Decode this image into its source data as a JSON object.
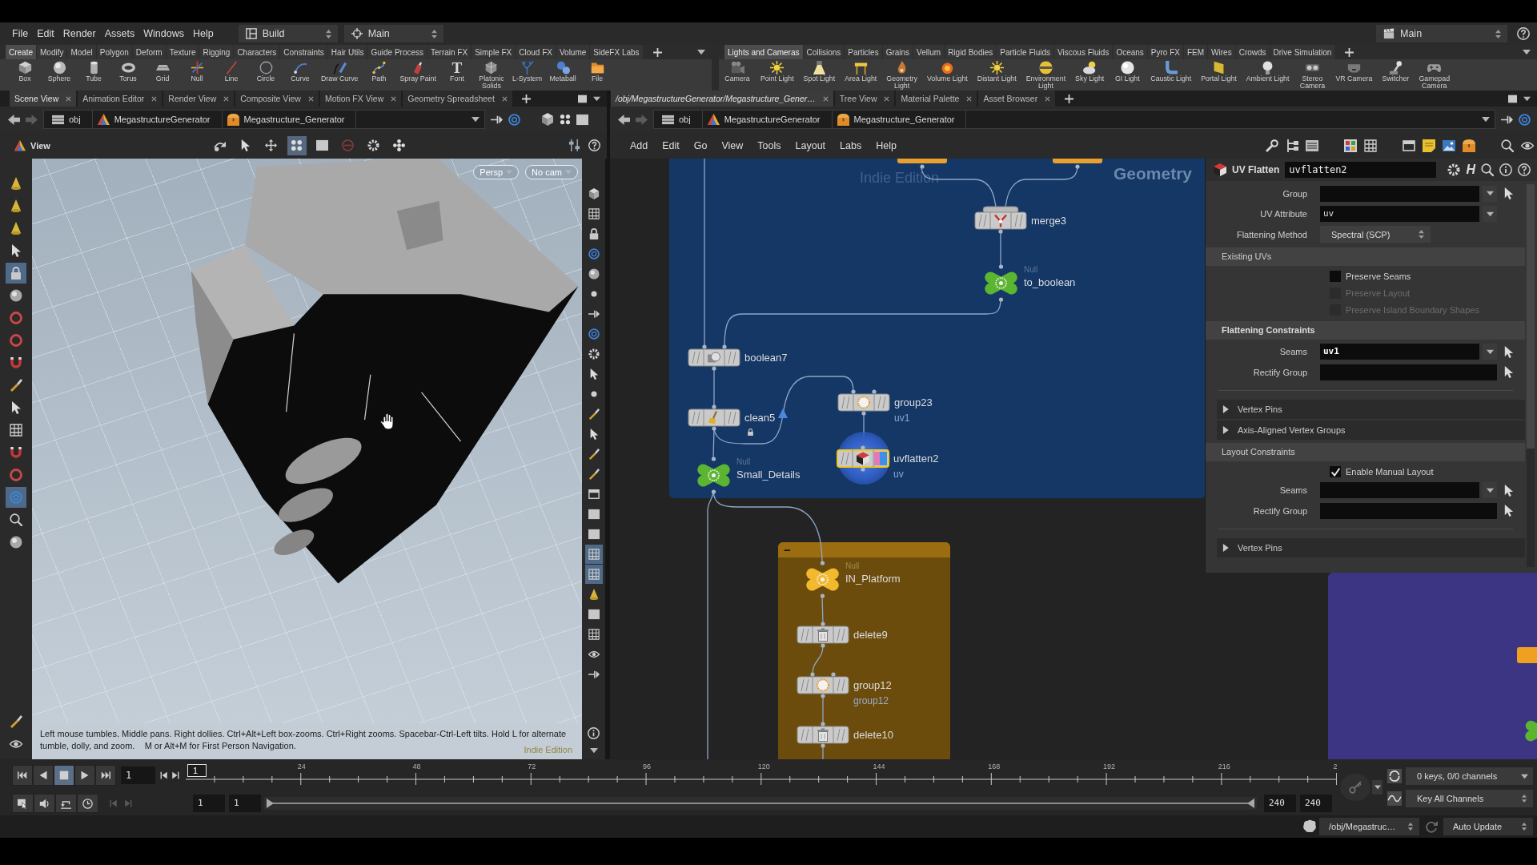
{
  "menu_bar": {
    "menus": [
      "File",
      "Edit",
      "Render",
      "Assets",
      "Windows",
      "Help"
    ],
    "desktop": "Build",
    "context": "Main",
    "right_desktop": "Main"
  },
  "shelf_left": {
    "tabs": [
      {
        "label": "Create",
        "selected": true
      },
      {
        "label": "Modify",
        "selected": false
      },
      {
        "label": "Model",
        "selected": false
      },
      {
        "label": "Polygon",
        "selected": false
      },
      {
        "label": "Deform",
        "selected": false
      },
      {
        "label": "Texture",
        "selected": false
      },
      {
        "label": "Rigging",
        "selected": false
      },
      {
        "label": "Characters",
        "selected": false
      },
      {
        "label": "Constraints",
        "selected": false
      },
      {
        "label": "Hair Utils",
        "selected": false
      },
      {
        "label": "Guide Process",
        "selected": false
      },
      {
        "label": "Terrain FX",
        "selected": false
      },
      {
        "label": "Simple FX",
        "selected": false
      },
      {
        "label": "Cloud FX",
        "selected": false
      },
      {
        "label": "Volume",
        "selected": false
      },
      {
        "label": "SideFX Labs",
        "selected": false
      }
    ],
    "tools": [
      {
        "label": "Box"
      },
      {
        "label": "Sphere"
      },
      {
        "label": "Tube"
      },
      {
        "label": "Torus"
      },
      {
        "label": "Grid"
      },
      {
        "label": "Null"
      },
      {
        "label": "Line"
      },
      {
        "label": "Circle"
      },
      {
        "label": "Curve"
      },
      {
        "label": "Draw Curve"
      },
      {
        "label": "Path"
      },
      {
        "label": "Spray Paint"
      },
      {
        "label": "Font",
        "glyph": "T"
      },
      {
        "label": "Platonic\nSolids"
      },
      {
        "label": "L-System"
      },
      {
        "label": "Metaball"
      },
      {
        "label": "File"
      }
    ]
  },
  "shelf_right": {
    "tabs": [
      {
        "label": "Lights and Cameras",
        "selected": true
      },
      {
        "label": "Collisions",
        "selected": false
      },
      {
        "label": "Particles",
        "selected": false
      },
      {
        "label": "Grains",
        "selected": false
      },
      {
        "label": "Vellum",
        "selected": false
      },
      {
        "label": "Rigid Bodies",
        "selected": false
      },
      {
        "label": "Particle Fluids",
        "selected": false
      },
      {
        "label": "Viscous Fluids",
        "selected": false
      },
      {
        "label": "Oceans",
        "selected": false
      },
      {
        "label": "Pyro FX",
        "selected": false
      },
      {
        "label": "FEM",
        "selected": false
      },
      {
        "label": "Wires",
        "selected": false
      },
      {
        "label": "Crowds",
        "selected": false
      },
      {
        "label": "Drive Simulation",
        "selected": false
      }
    ],
    "tools": [
      {
        "label": "Camera"
      },
      {
        "label": "Point Light"
      },
      {
        "label": "Spot Light"
      },
      {
        "label": "Area Light"
      },
      {
        "label": "Geometry\nLight"
      },
      {
        "label": "Volume Light"
      },
      {
        "label": "Distant Light"
      },
      {
        "label": "Environment\nLight"
      },
      {
        "label": "Sky Light"
      },
      {
        "label": "GI Light"
      },
      {
        "label": "Caustic Light"
      },
      {
        "label": "Portal Light"
      },
      {
        "label": "Ambient Light"
      },
      {
        "label": "Stereo\nCamera"
      },
      {
        "label": "VR Camera"
      },
      {
        "label": "Switcher"
      },
      {
        "label": "Gamepad\nCamera"
      }
    ]
  },
  "scene_pane": {
    "tabs": [
      {
        "label": "Scene View",
        "selected": true
      },
      {
        "label": "Animation Editor",
        "selected": false
      },
      {
        "label": "Render View",
        "selected": false
      },
      {
        "label": "Composite View",
        "selected": false
      },
      {
        "label": "Motion FX View",
        "selected": false
      },
      {
        "label": "Geometry Spreadsheet",
        "selected": false
      }
    ],
    "path": [
      "obj",
      "MegastructureGenerator",
      "Megastructure_Generator"
    ],
    "view_label": "View",
    "top_tools": [
      {
        "on": false
      },
      {
        "on": false
      },
      {
        "on": false
      },
      {
        "on": true
      },
      {
        "on": false
      },
      {
        "on": false
      },
      {
        "on": false
      },
      {
        "on": false
      }
    ],
    "left_tools": [
      {
        "on": false
      },
      {
        "on": false
      },
      {
        "on": false
      },
      {
        "on": false
      },
      {
        "on": true
      },
      {
        "on": false
      },
      {
        "on": false
      },
      {
        "on": false
      },
      {
        "on": false
      },
      {
        "on": false
      },
      {
        "on": false
      },
      {
        "on": false
      },
      {
        "on": false
      },
      {
        "on": false
      },
      {
        "on": true
      },
      {
        "on": false
      },
      {
        "on": false
      },
      {
        "on": false
      },
      {
        "on": false
      }
    ],
    "right_tools": [
      {
        "on": false
      },
      {
        "on": false
      },
      {
        "on": false
      },
      {
        "on": false
      },
      {
        "on": false
      },
      {
        "on": false
      },
      {
        "on": false
      },
      {
        "on": false
      },
      {
        "on": false
      },
      {
        "on": false
      },
      {
        "on": false
      },
      {
        "on": false
      },
      {
        "on": false
      },
      {
        "on": false
      },
      {
        "on": false
      },
      {
        "on": false
      },
      {
        "on": false
      },
      {
        "on": false
      },
      {
        "on": true
      },
      {
        "on": true
      },
      {
        "on": false
      },
      {
        "on": false
      },
      {
        "on": false
      },
      {
        "on": false
      },
      {
        "on": false
      }
    ],
    "camera_menus": [
      "Persp",
      "No cam"
    ],
    "help_text": "Left mouse tumbles. Middle pans. Right dollies. Ctrl+Alt+Left box-zooms. Ctrl+Right zooms. Spacebar-Ctrl-Left tilts. Hold L for alternate tumble, dolly, and zoom.    M or Alt+M for First Person Navigation.",
    "edition_label": "Indie Edition"
  },
  "network_pane": {
    "tabs": [
      {
        "label": "/obj/MegastructureGenerator/Megastructure_Gener…",
        "kind": "path",
        "selected": true
      },
      {
        "label": "Tree View",
        "kind": "pane",
        "selected": false
      },
      {
        "label": "Material Palette",
        "kind": "pane",
        "selected": false
      },
      {
        "label": "Asset Browser",
        "kind": "pane",
        "selected": false
      }
    ],
    "path": [
      "obj",
      "MegastructureGenerator",
      "Megastructure_Generator"
    ],
    "menus": [
      "Add",
      "Edit",
      "Go",
      "View",
      "Tools",
      "Layout",
      "Labs",
      "Help"
    ],
    "edition_label": "Indie Edition",
    "boxes": [
      {
        "label": "Geometry",
        "color": "#143766"
      },
      {
        "collapse_glyph": "−",
        "color": "#6b4c0c"
      },
      {
        "color": "#3b3583"
      }
    ],
    "nodes": [
      {
        "name": "merge3",
        "kind": "merge",
        "color": "#cacaca",
        "selected": false,
        "display_flag": false,
        "locked": false
      },
      {
        "name": "to_boolean",
        "kind": "null",
        "type_label": "Null",
        "color": "#5cb531",
        "selected": false,
        "display_flag": false,
        "locked": false
      },
      {
        "name": "boolean7",
        "kind": "sop",
        "color": "#cacaca",
        "selected": false,
        "display_flag": false,
        "locked": false
      },
      {
        "name": "clean5",
        "kind": "sop",
        "color": "#cacaca",
        "selected": false,
        "display_flag": false,
        "locked": true
      },
      {
        "name": "group23",
        "kind": "sop",
        "comment": "uv1",
        "color": "#cacaca",
        "selected": false,
        "display_flag": false,
        "locked": false
      },
      {
        "name": "Small_Details",
        "kind": "null",
        "type_label": "Null",
        "color": "#5cb531",
        "selected": false,
        "display_flag": false,
        "locked": false
      },
      {
        "name": "uvflatten2",
        "kind": "sop",
        "comment": "uv",
        "color": "#cacaca",
        "selected": true,
        "display_flag": true,
        "locked": false
      },
      {
        "name": "IN_Platform",
        "kind": "null",
        "type_label": "Null",
        "color": "#f2b82e",
        "selected": false,
        "display_flag": false,
        "locked": false
      },
      {
        "name": "delete9",
        "kind": "sop",
        "color": "#cacaca",
        "selected": false,
        "display_flag": false,
        "locked": false
      },
      {
        "name": "group12",
        "kind": "sop",
        "comment": "group12",
        "color": "#cacaca",
        "selected": false,
        "display_flag": false,
        "locked": false
      },
      {
        "name": "delete10",
        "kind": "sop",
        "color": "#cacaca",
        "selected": false,
        "display_flag": false,
        "locked": false
      }
    ],
    "partial_nodes": [
      {
        "kind": "sop",
        "color": "#e8a030"
      },
      {
        "kind": "sop",
        "color": "#e8a030"
      },
      {
        "kind": "sop",
        "color": "#f0a020"
      },
      {
        "kind": "null",
        "color": "#5cb531"
      }
    ]
  },
  "parameters": {
    "node_type": "UV Flatten",
    "node_name": "uvflatten2",
    "header_glyph": "H",
    "rows": [
      {
        "kind": "field",
        "label": "Group",
        "menu": true,
        "picker": true
      },
      {
        "kind": "field",
        "label": "UV Attribute",
        "value": "uv",
        "menu": true,
        "picker": false,
        "modified": false
      },
      {
        "kind": "menu",
        "label": "Flattening Method",
        "value": "Spectral (SCP)"
      },
      {
        "kind": "section",
        "label": "Existing UVs",
        "modified": false
      },
      {
        "kind": "checkbox",
        "label": "Preserve Seams",
        "checked": false,
        "disabled": false
      },
      {
        "kind": "checkbox",
        "label": "Preserve Layout",
        "checked": false,
        "disabled": true
      },
      {
        "kind": "checkbox",
        "label": "Preserve Island Boundary Shapes",
        "checked": false,
        "disabled": true
      },
      {
        "kind": "section",
        "label": "Flattening Constraints",
        "modified": true
      },
      {
        "kind": "field",
        "label": "Seams",
        "value": "uv1",
        "menu": true,
        "picker": true,
        "modified": true
      },
      {
        "kind": "field",
        "label": "Rectify Group",
        "menu": false,
        "picker": true
      },
      {
        "kind": "separator"
      },
      {
        "kind": "folder",
        "label": "Vertex Pins",
        "expanded": false
      },
      {
        "kind": "folder",
        "label": "Axis-Aligned Vertex Groups",
        "expanded": false
      },
      {
        "kind": "section",
        "label": "Layout Constraints",
        "modified": false
      },
      {
        "kind": "checkbox",
        "label": "Enable Manual Layout",
        "checked": true,
        "disabled": false
      },
      {
        "kind": "field",
        "label": "Seams",
        "menu": true,
        "picker": true
      },
      {
        "kind": "field",
        "label": "Rectify Group",
        "menu": false,
        "picker": true
      },
      {
        "kind": "separator"
      },
      {
        "kind": "folder",
        "label": "Vertex Pins",
        "expanded": false
      }
    ]
  },
  "timeline": {
    "playing": false,
    "frame": "1",
    "marker": "1",
    "ticks": [
      "24",
      "48",
      "72",
      "96",
      "120",
      "144",
      "168",
      "192",
      "216",
      "2"
    ],
    "range_fields": [
      "1",
      "1",
      "240",
      "240"
    ],
    "range_bar": {
      "level": 1
    },
    "keys_menu": "0 keys, 0/0 channels",
    "key_mode": "Key All Channels"
  },
  "status_bar": {
    "path": "/obj/Megastruc…",
    "update_mode": "Auto Update"
  }
}
